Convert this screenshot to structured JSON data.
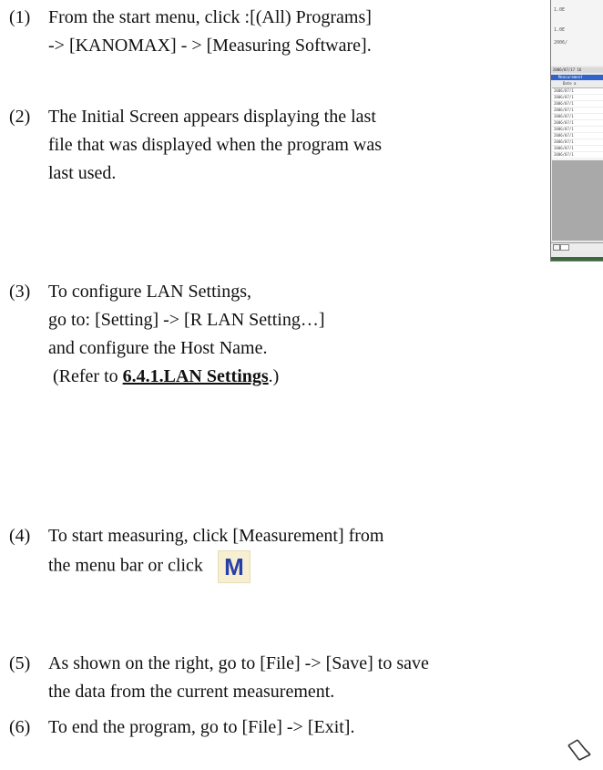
{
  "steps": [
    {
      "number": "(1)",
      "lines": [
        "From the start menu, click :[(All) Programs]",
        "-> [KANOMAX] - > [Measuring Software]."
      ]
    },
    {
      "number": "(2)",
      "lines": [
        "The Initial Screen appears displaying the last",
        "file that was displayed when the program was",
        "last used."
      ]
    },
    {
      "number": "(3)",
      "lines": [
        "To configure LAN Settings,",
        "go to: [Setting] -> [R LAN Setting…]",
        "and configure the Host Name."
      ],
      "ref_prefix": " (Refer to ",
      "ref_link": "6.4.1.LAN Settings",
      "ref_suffix": ".)"
    },
    {
      "number": "(4)",
      "lines": [
        "To start measuring, click [Measurement] from",
        "the menu bar or click"
      ],
      "button_label": "M"
    },
    {
      "number": "(5)",
      "lines": [
        "As shown on the right, go to [File] -> [Save] to save",
        "the data from the current measurement."
      ]
    },
    {
      "number": "(6)",
      "lines": [
        "To end the program, go to [File] -> [Exit]."
      ]
    }
  ],
  "screenshot": {
    "graph_ticks": [
      "1.0E",
      "1.0E",
      "2006/"
    ],
    "status_text": "2006/07/17 16",
    "window_title": "Measurement",
    "table_header": "Date a",
    "rows": [
      "2006/07/1",
      "2006/07/1",
      "2006/07/1",
      "2006/07/1",
      "2006/07/1",
      "2006/07/1",
      "2006/07/1",
      "2006/07/1",
      "2006/07/1",
      "2006/07/1",
      "2006/07/1"
    ]
  }
}
